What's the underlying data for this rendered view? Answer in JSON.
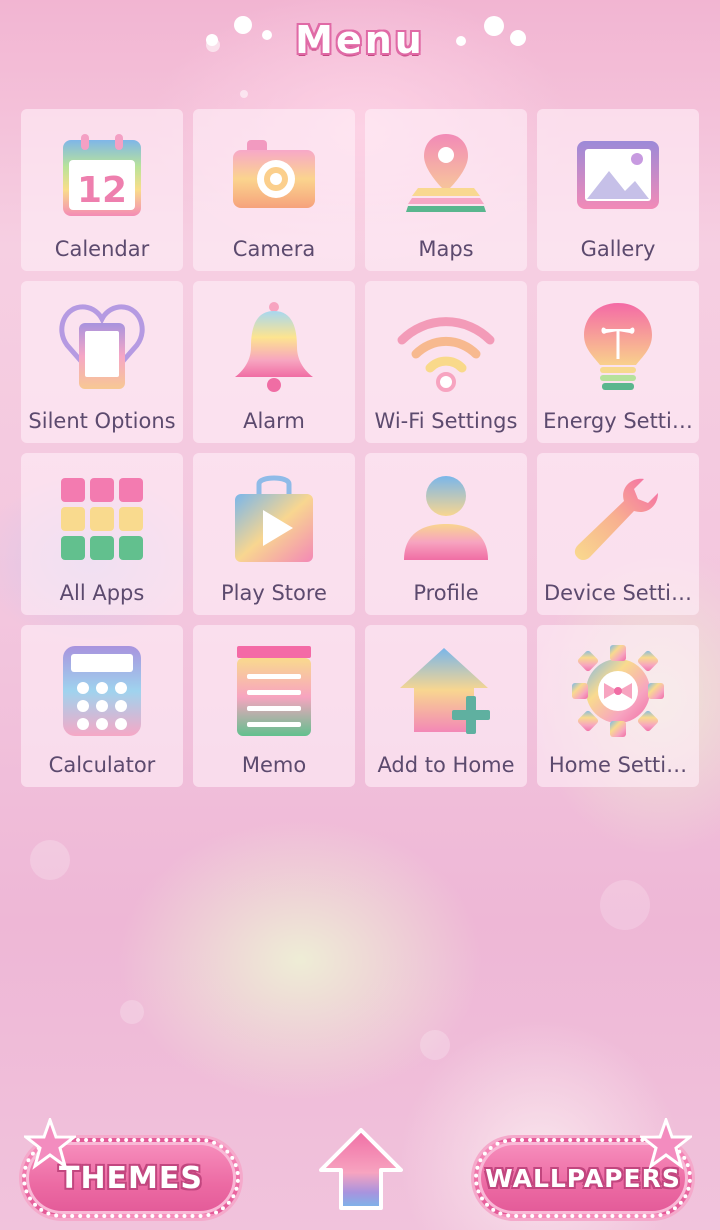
{
  "header": {
    "title": "Menu"
  },
  "apps": [
    {
      "label": "Calendar",
      "icon": "calendar-icon",
      "name": "calendar"
    },
    {
      "label": "Camera",
      "icon": "camera-icon",
      "name": "camera"
    },
    {
      "label": "Maps",
      "icon": "map-pin-icon",
      "name": "maps"
    },
    {
      "label": "Gallery",
      "icon": "gallery-icon",
      "name": "gallery"
    },
    {
      "label": "Silent Options",
      "icon": "heart-phone-icon",
      "name": "silent-options"
    },
    {
      "label": "Alarm",
      "icon": "bell-icon",
      "name": "alarm"
    },
    {
      "label": "Wi-Fi Settings",
      "icon": "wifi-icon",
      "name": "wifi-settings"
    },
    {
      "label": "Energy Setti…",
      "icon": "lightbulb-icon",
      "name": "energy-settings"
    },
    {
      "label": "All Apps",
      "icon": "app-grid-icon",
      "name": "all-apps"
    },
    {
      "label": "Play Store",
      "icon": "shopping-bag-play-icon",
      "name": "play-store"
    },
    {
      "label": "Profile",
      "icon": "person-icon",
      "name": "profile"
    },
    {
      "label": "Device Setti…",
      "icon": "wrench-icon",
      "name": "device-settings"
    },
    {
      "label": "Calculator",
      "icon": "calculator-icon",
      "name": "calculator"
    },
    {
      "label": "Memo",
      "icon": "notepad-icon",
      "name": "memo"
    },
    {
      "label": "Add to Home",
      "icon": "house-plus-icon",
      "name": "add-to-home"
    },
    {
      "label": "Home Setti…",
      "icon": "gear-bow-icon",
      "name": "home-settings"
    }
  ],
  "calendar_day": "12",
  "bottom": {
    "themes_label": "THEMES",
    "wallpapers_label": "WALLPAPERS"
  },
  "colors": {
    "tile_bg": "#fdf0f6",
    "label": "#5c4a6e",
    "accent": "#ec6aa3"
  }
}
